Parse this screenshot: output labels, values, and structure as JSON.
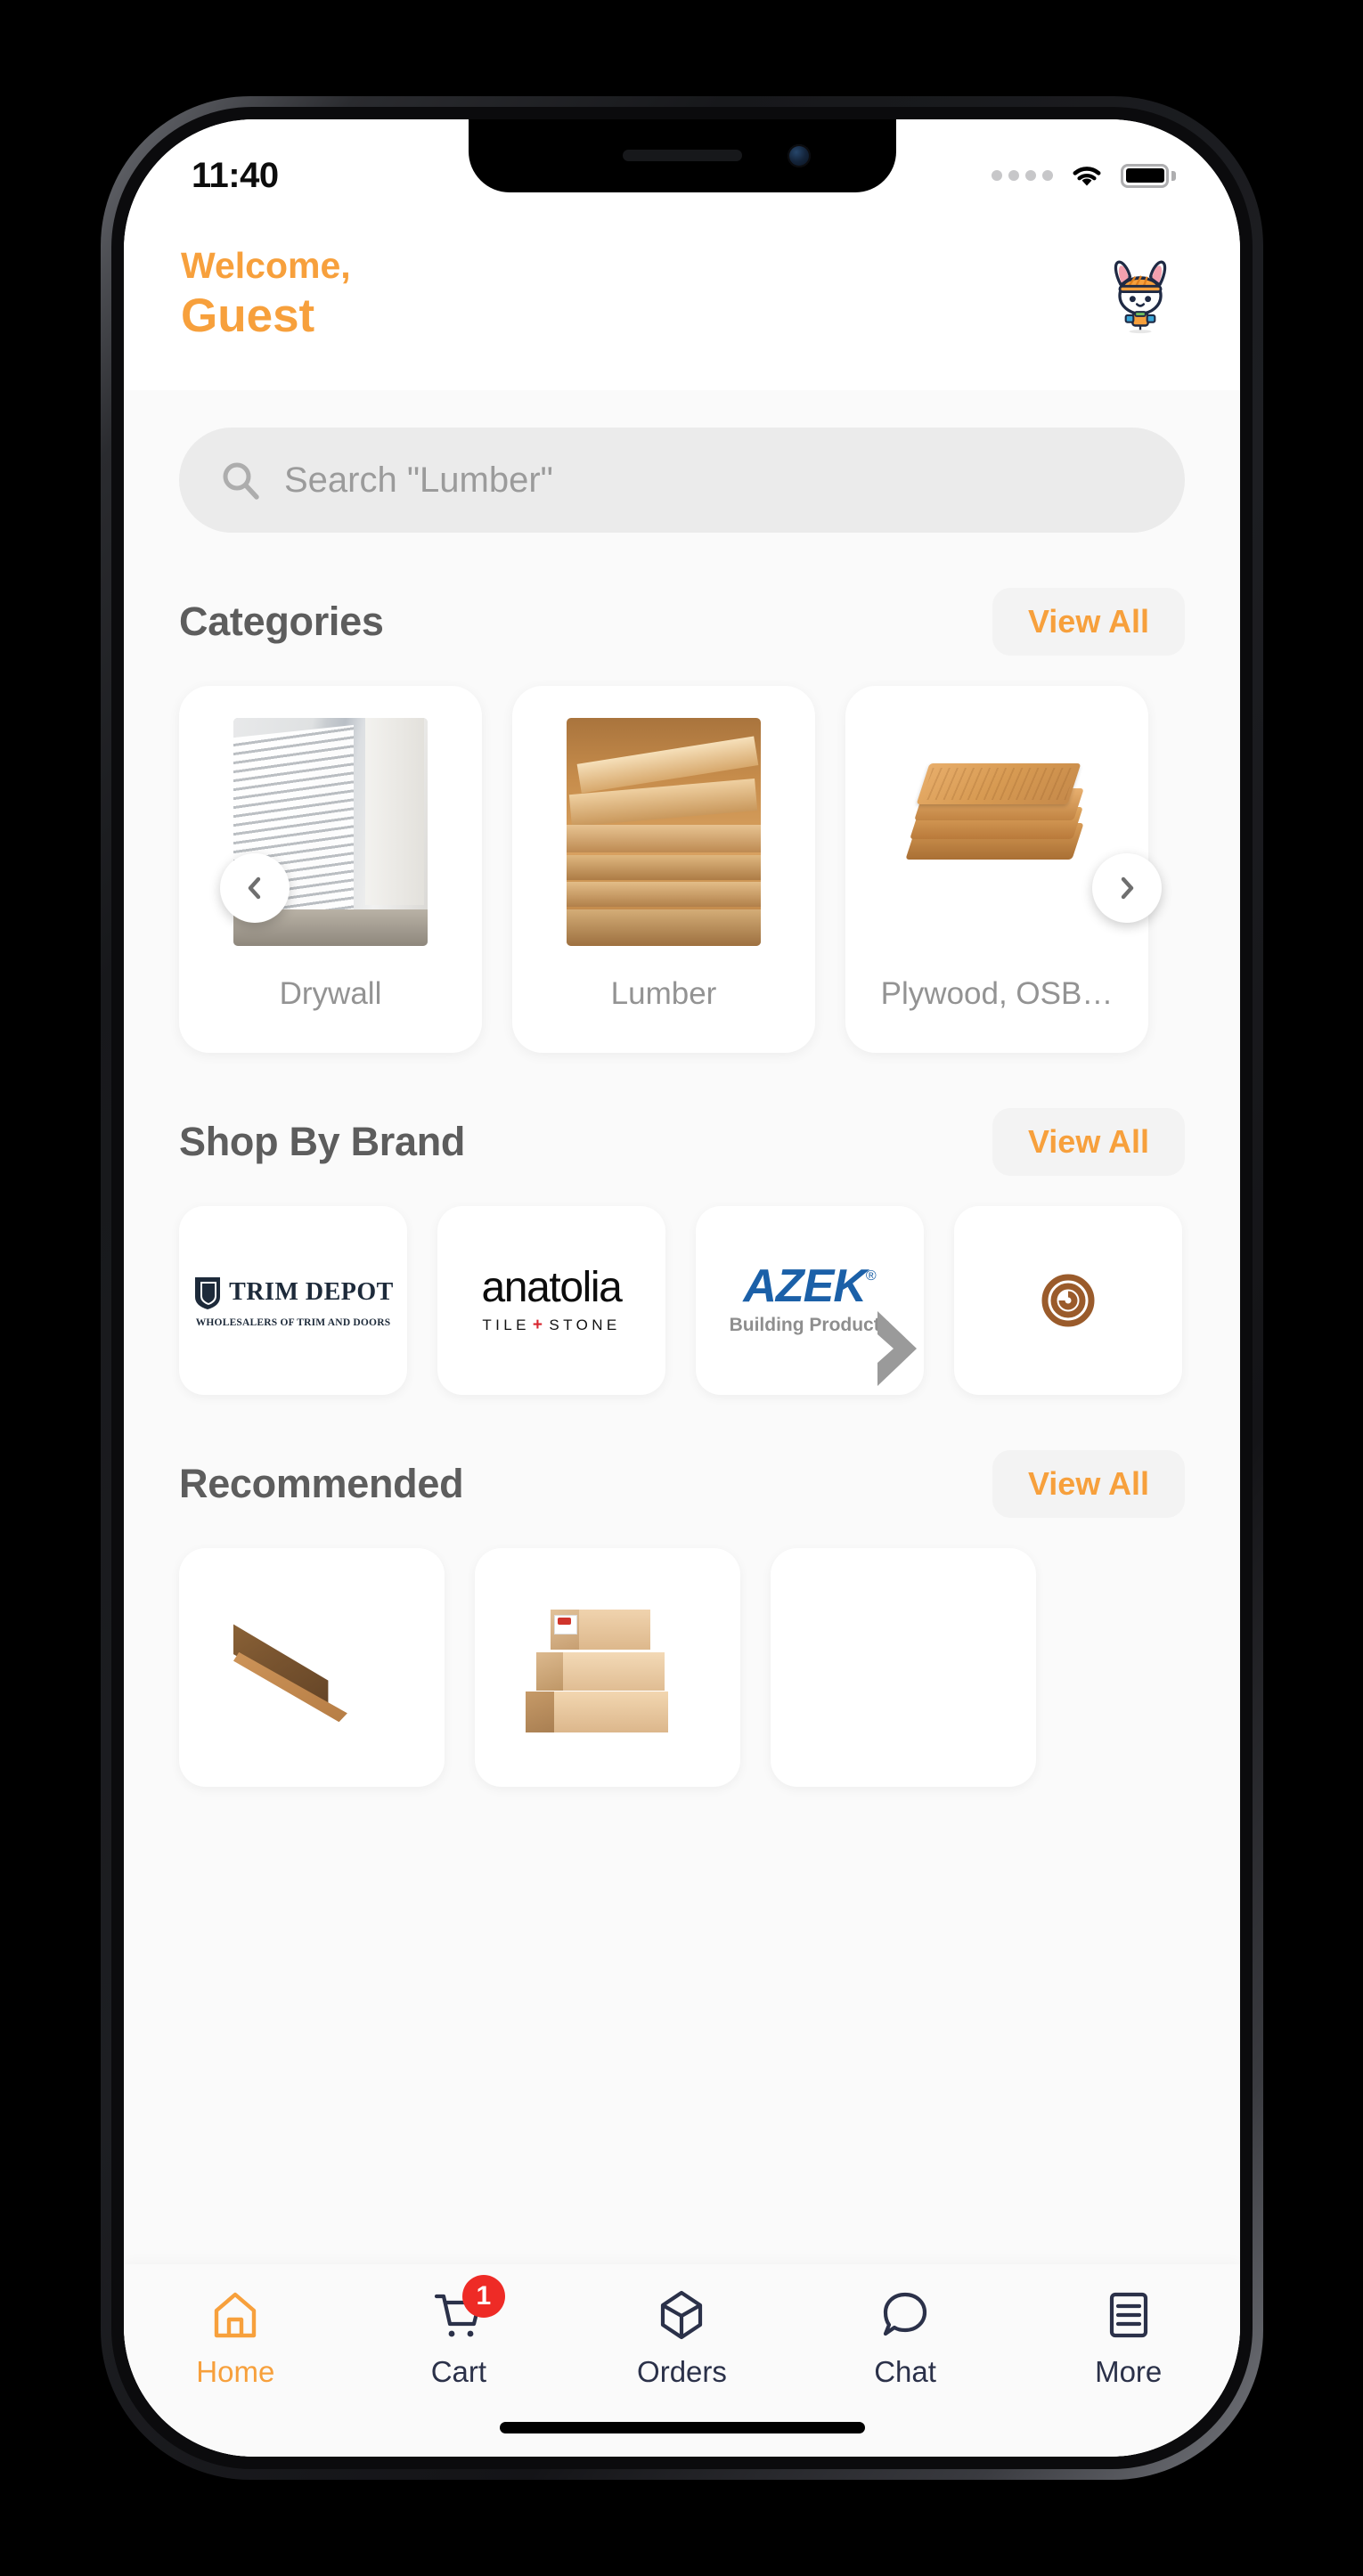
{
  "status_bar": {
    "time": "11:40",
    "signal_icon": "signal-dots-icon",
    "wifi_icon": "wifi-icon",
    "battery_icon": "battery-full-icon"
  },
  "header": {
    "welcome_line": "Welcome,",
    "user_name": "Guest",
    "avatar_icon": "bunny-mascot-avatar"
  },
  "search": {
    "placeholder": "Search \"Lumber\"",
    "icon": "search-icon"
  },
  "sections": {
    "categories": {
      "title": "Categories",
      "view_all": "View All",
      "prev_icon": "chevron-left-icon",
      "next_icon": "chevron-right-icon",
      "items": [
        {
          "label": "Drywall",
          "image": "drywall-sheets-photo"
        },
        {
          "label": "Lumber",
          "image": "lumber-stack-photo"
        },
        {
          "label": "Plywood, OSB…",
          "image": "plywood-sheets-photo"
        }
      ]
    },
    "brands": {
      "title": "Shop By Brand",
      "view_all": "View All",
      "items": [
        {
          "name": "TRIM DEPOT",
          "tagline": "WHOLESALERS OF TRIM AND DOORS",
          "logo": "trim-depot-logo"
        },
        {
          "name": "anatolia",
          "tagline": "TILE + STONE",
          "logo": "anatolia-logo"
        },
        {
          "name": "AZEK",
          "tagline": "Building Products",
          "logo": "azek-logo"
        },
        {
          "name": "",
          "tagline": "",
          "logo": "spiral-brand-logo"
        }
      ]
    },
    "recommended": {
      "title": "Recommended",
      "view_all": "View All",
      "items": [
        {
          "image": "brown-lumber-board-photo"
        },
        {
          "image": "stacked-lumber-boards-photo"
        },
        {
          "image": "partial-product-photo"
        }
      ]
    }
  },
  "bottom_nav": {
    "items": [
      {
        "label": "Home",
        "icon": "home-icon",
        "active": true,
        "badge": ""
      },
      {
        "label": "Cart",
        "icon": "cart-icon",
        "active": false,
        "badge": "1"
      },
      {
        "label": "Orders",
        "icon": "box-icon",
        "active": false,
        "badge": ""
      },
      {
        "label": "Chat",
        "icon": "chat-icon",
        "active": false,
        "badge": ""
      },
      {
        "label": "More",
        "icon": "menu-icon",
        "active": false,
        "badge": ""
      }
    ]
  },
  "colors": {
    "accent_orange": "#F7A03C",
    "badge_red": "#EE2B26",
    "nav_dark": "#2B3149",
    "section_title": "#5D5D5D",
    "screen_bg": "#FAFAFA"
  }
}
